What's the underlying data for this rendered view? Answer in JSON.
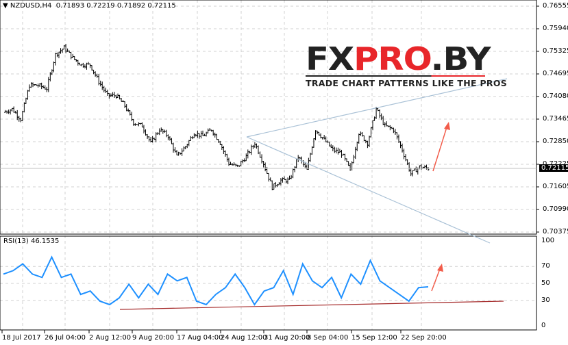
{
  "header": {
    "symbol": "NZDUSD,H4",
    "open": "0.71893",
    "high": "0.72219",
    "low": "0.71892",
    "close": "0.72115"
  },
  "logo": {
    "brand_dark1": "FX",
    "brand_red": "PRO",
    "brand_dark2": ".BY",
    "tagline": "TRADE CHART PATTERNS LIKE THE PROS"
  },
  "rsi": {
    "label": "RSI(13) 46.1535",
    "ticks": [
      "100",
      "70",
      "50",
      "30",
      "0"
    ]
  },
  "price_axis": {
    "labels": [
      "0.76555",
      "0.75940",
      "0.75325",
      "0.74695",
      "0.74080",
      "0.73465",
      "0.72850",
      "0.72225",
      "0.71605",
      "0.70990",
      "0.70375"
    ],
    "current": "0.72115"
  },
  "time_axis": {
    "labels": [
      "18 Jul 2017",
      "26 Jul 04:00",
      "2 Aug 12:00",
      "9 Aug 20:00",
      "17 Aug 04:00",
      "24 Aug 12:00",
      "31 Aug 20:00",
      "8 Sep 04:00",
      "15 Sep 12:00",
      "22 Sep 20:00"
    ]
  },
  "colors": {
    "bars": "#000000",
    "rsi_line": "#1e90ff",
    "trendline": "#a9c1d6",
    "rsi_trendline": "#a52a2a",
    "arrow": "#f25c4a",
    "grid": "#c8c8c8"
  },
  "chart_data": {
    "type": "line",
    "title": "NZDUSD,H4",
    "price_range": [
      0.70375,
      0.76555
    ],
    "price_closes": [
      0.7365,
      0.7374,
      0.7346,
      0.7439,
      0.7439,
      0.743,
      0.7523,
      0.7542,
      0.7514,
      0.7495,
      0.7495,
      0.7449,
      0.7411,
      0.7411,
      0.7383,
      0.7337,
      0.7328,
      0.7281,
      0.7318,
      0.73,
      0.7244,
      0.7272,
      0.7309,
      0.73,
      0.7318,
      0.7281,
      0.7225,
      0.7216,
      0.7244,
      0.7281,
      0.7225,
      0.716,
      0.7179,
      0.7179,
      0.7244,
      0.7207,
      0.7318,
      0.729,
      0.7262,
      0.7253,
      0.7207,
      0.7309,
      0.7281,
      0.7374,
      0.7328,
      0.7318,
      0.7262,
      0.7197,
      0.7216,
      0.72115
    ],
    "rsi_range": [
      0,
      100
    ],
    "rsi_values": [
      61,
      65,
      73,
      61,
      57,
      81,
      57,
      61,
      37,
      41,
      29,
      25,
      33,
      49,
      33,
      49,
      37,
      61,
      53,
      57,
      29,
      25,
      37,
      45,
      61,
      45,
      25,
      41,
      45,
      65,
      37,
      73,
      53,
      45,
      57,
      33,
      61,
      49,
      77,
      53,
      45,
      37,
      29,
      45,
      46
    ]
  }
}
